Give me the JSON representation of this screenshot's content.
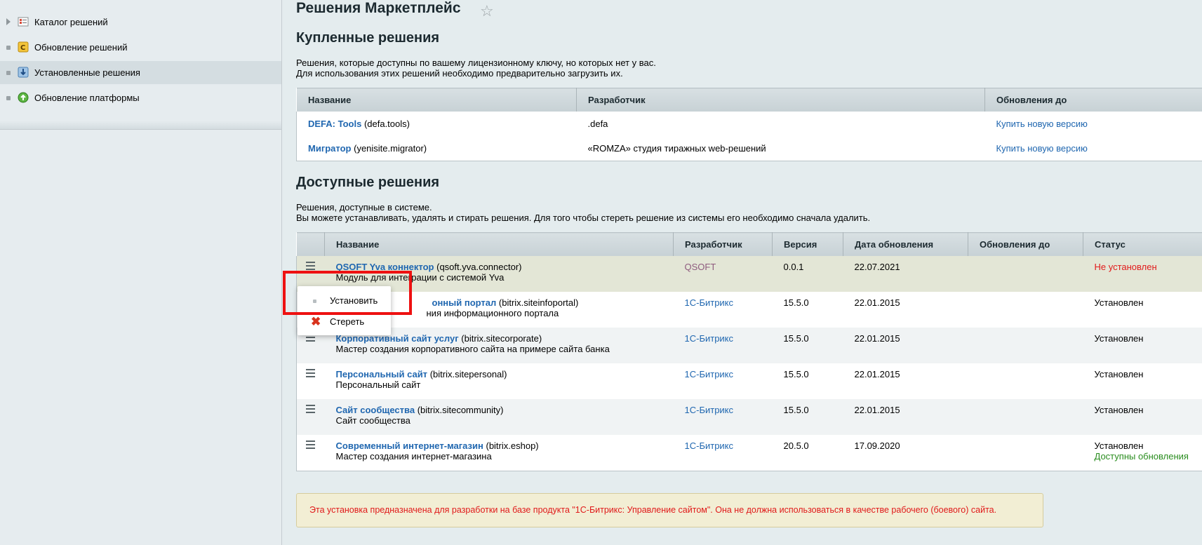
{
  "sidebar": {
    "items": [
      {
        "label": "Каталог решений",
        "icon": "catalog-icon",
        "marker": "arrow"
      },
      {
        "label": "Обновление решений",
        "icon": "update-solutions-icon",
        "marker": "bullet"
      },
      {
        "label": "Установленные решения",
        "icon": "installed-solutions-icon",
        "marker": "bullet",
        "active": true
      },
      {
        "label": "Обновление платформы",
        "icon": "platform-update-icon",
        "marker": "bullet"
      }
    ]
  },
  "page": {
    "title": "Решения Маркетплейс"
  },
  "bought": {
    "title": "Купленные решения",
    "desc_line1": "Решения, которые доступны по вашему лицензионному ключу, но которых нет у вас.",
    "desc_line2": "Для использования этих решений необходимо предварительно загрузить их.",
    "headers": {
      "name": "Название",
      "developer": "Разработчик",
      "updates_until": "Обновления до"
    },
    "rows": [
      {
        "name": "DEFA: Tools",
        "code": "(defa.tools)",
        "developer": ".defa",
        "action": "Купить новую версию"
      },
      {
        "name": "Мигратор",
        "code": "(yenisite.migrator)",
        "developer": "«ROMZA» студия тиражных web-решений",
        "action": "Купить новую версию"
      }
    ]
  },
  "available": {
    "title": "Доступные решения",
    "desc_line1": "Решения, доступные в системе.",
    "desc_line2": "Вы можете устанавливать, удалять и стирать решения. Для того чтобы стереть решение из системы его необходимо сначала удалить.",
    "headers": {
      "name": "Название",
      "developer": "Разработчик",
      "version": "Версия",
      "date": "Дата обновления",
      "updates_until": "Обновления до",
      "status": "Статус"
    },
    "rows": [
      {
        "name": "QSOFT Yva коннектор",
        "code": "(qsoft.yva.connector)",
        "desc": "Модуль для интеграции с системой Yva",
        "developer": "QSOFT",
        "version": "0.0.1",
        "date": "22.07.2021",
        "status": "Не установлен",
        "status2": ""
      },
      {
        "name": "онный портал",
        "code": "(bitrix.siteinfoportal)",
        "desc": "ния информационного портала",
        "developer": "1С-Битрикс",
        "version": "15.5.0",
        "date": "22.01.2015",
        "status": "Установлен",
        "status2": ""
      },
      {
        "name": "Корпоративный сайт услуг",
        "code": "(bitrix.sitecorporate)",
        "desc": "Мастер создания корпоративного сайта на примере сайта банка",
        "developer": "1С-Битрикс",
        "version": "15.5.0",
        "date": "22.01.2015",
        "status": "Установлен",
        "status2": ""
      },
      {
        "name": "Персональный сайт",
        "code": "(bitrix.sitepersonal)",
        "desc": "Персональный сайт",
        "developer": "1С-Битрикс",
        "version": "15.5.0",
        "date": "22.01.2015",
        "status": "Установлен",
        "status2": ""
      },
      {
        "name": "Сайт сообщества",
        "code": "(bitrix.sitecommunity)",
        "desc": "Сайт сообщества",
        "developer": "1С-Битрикс",
        "version": "15.5.0",
        "date": "22.01.2015",
        "status": "Установлен",
        "status2": ""
      },
      {
        "name": "Современный интернет-магазин",
        "code": "(bitrix.eshop)",
        "desc": "Мастер создания интернет-магазина",
        "developer": "1С-Битрикс",
        "version": "20.5.0",
        "date": "17.09.2020",
        "status": "Установлен",
        "status2": "Доступны обновления"
      }
    ]
  },
  "popup": {
    "install": "Установить",
    "erase": "Стереть"
  },
  "notice": {
    "text": "Эта установка предназначена для разработки на базе продукта \"1С-Битрикс: Управление сайтом\". Она не должна использоваться в качестве рабочего (боевого) сайта."
  },
  "colors": {
    "link": "#2067b0",
    "status_not_installed": "#e21b1b",
    "status_updates": "#2a8d1f",
    "highlight_frame": "#ee1111"
  }
}
